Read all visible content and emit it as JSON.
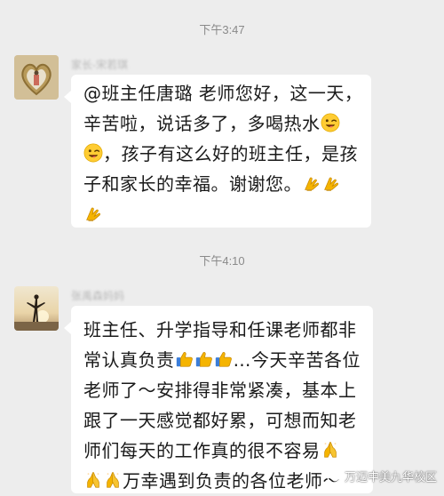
{
  "chat": {
    "timestamp_1": "下午3:47",
    "timestamp_2": "下午4:10",
    "messages": [
      {
        "sender": "家长-宋若琪",
        "lines": [
          "@班主任唐璐  老师您好，这一天，",
          "辛苦啦，说话多了，多喝热水",
          "，孩子有这么好的班主任，是孩",
          "子和家长的幸福。谢谢您。",
          ""
        ]
      },
      {
        "sender": "张禹森妈妈",
        "lines": [
          "班主任、升学指导和任课老师都非",
          "常认真负责",
          "…今天辛苦各位",
          "老师了～安排得非常紧凑，基本上",
          "跟了一天感觉都好累，可想而知老",
          "师们每天的工作真的很不容易",
          "万幸遇到负责的各位老师～"
        ]
      }
    ]
  },
  "watermark": {
    "text": "万迈中美九华校区",
    "icon": "wechat-channel-icon"
  },
  "icons": {
    "wink": "winking-face-tongue-icon",
    "praise": "folded-hands-icon",
    "thumbs": "thumbs-up-icon"
  },
  "colors": {
    "background": "#ededed",
    "bubble": "#ffffff",
    "text": "#1a1a1a",
    "timestamp": "#8a8a8a"
  }
}
